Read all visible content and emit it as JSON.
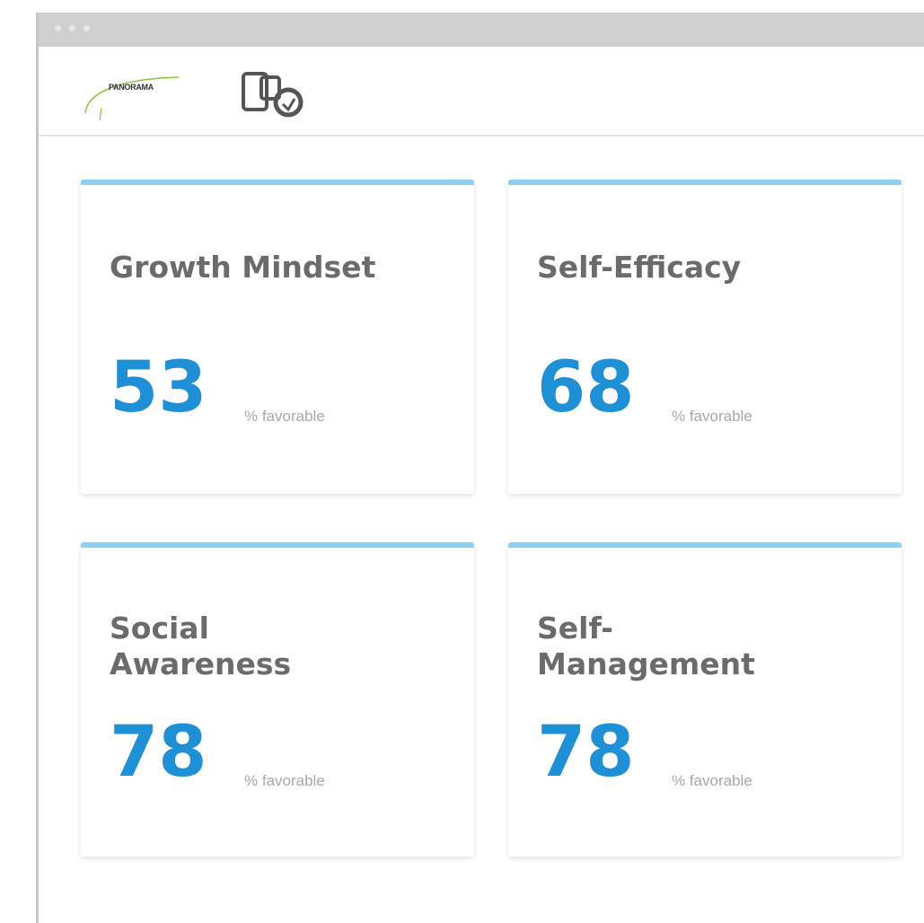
{
  "header": {
    "brand_name": "PANORAMA"
  },
  "cards": [
    {
      "title": "Growth Mindset",
      "value": "53",
      "unit": "% favorable"
    },
    {
      "title": "Self-Efficacy",
      "value": "68",
      "unit": "% favorable"
    },
    {
      "title": "Social\nAwareness",
      "value": "78",
      "unit": "% favorable"
    },
    {
      "title": "Self-\nManagement",
      "value": "78",
      "unit": "% favorable"
    }
  ],
  "colors": {
    "accent": "#1f8fd6",
    "card_top_border": "#8fd0f0",
    "title_text": "#6b6b6b",
    "unit_text": "#a8a8a8"
  }
}
